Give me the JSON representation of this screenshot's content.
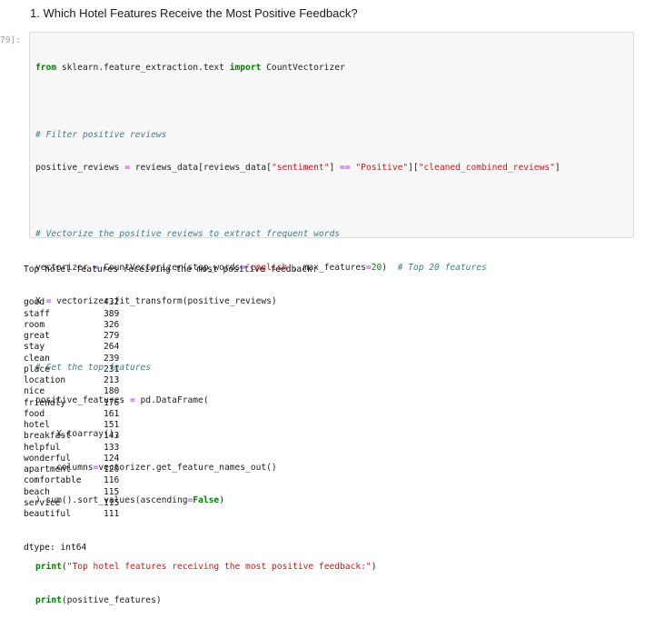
{
  "heading": "1. Which Hotel Features Receive the Most Positive Feedback?",
  "cell": {
    "prompt": "79]:",
    "code": {
      "line1": {
        "kw1": "from",
        "mod": " sklearn.feature_extraction.text ",
        "kw2": "import",
        "name": " CountVectorizer"
      },
      "line2": {
        "comment": "# Filter positive reviews"
      },
      "line3": {
        "a": "positive_reviews ",
        "op1": "=",
        "b": " reviews_data[reviews_data[",
        "s1": "\"sentiment\"",
        "c": "] ",
        "op2": "==",
        "d": " ",
        "s2": "\"Positive\"",
        "e": "][",
        "s3": "\"cleaned_combined_reviews\"",
        "f": "]"
      },
      "line4": {
        "comment": "# Vectorize the positive reviews to extract frequent words"
      },
      "line5": {
        "a": "vectorizer ",
        "op1": "=",
        "b": " CountVectorizer(stop_words",
        "op2": "=",
        "s1": "'english'",
        "c": ", max_features",
        "op3": "=",
        "n1": "20",
        "d": ")  ",
        "comment": "# Top 20 features"
      },
      "line6": {
        "a": "X ",
        "op1": "=",
        "b": " vectorizer.fit_transform(positive_reviews)"
      },
      "line7": {
        "comment": "# Get the top features"
      },
      "line8": {
        "a": "positive_features ",
        "op1": "=",
        "b": " pd.DataFrame("
      },
      "line9": {
        "a": "    X.toarray(),"
      },
      "line10": {
        "a": "    columns",
        "op1": "=",
        "b": "vectorizer.get_feature_names_out()"
      },
      "line11": {
        "a": ").sum().sort_values(ascending",
        "op1": "=",
        "kw1": "False",
        "b": ")"
      },
      "line12": {
        "kw1": "print",
        "a": "(",
        "s1": "\"Top hotel features receiving the most positive feedback:\"",
        "b": ")"
      },
      "line13": {
        "kw1": "print",
        "a": "(positive_features)"
      }
    }
  },
  "output": {
    "header": "Top hotel features receiving the most positive feedback:",
    "rows": [
      {
        "word": "good",
        "count": "432"
      },
      {
        "word": "staff",
        "count": "389"
      },
      {
        "word": "room",
        "count": "326"
      },
      {
        "word": "great",
        "count": "279"
      },
      {
        "word": "stay",
        "count": "264"
      },
      {
        "word": "clean",
        "count": "239"
      },
      {
        "word": "place",
        "count": "231"
      },
      {
        "word": "location",
        "count": "213"
      },
      {
        "word": "nice",
        "count": "180"
      },
      {
        "word": "friendly",
        "count": "176"
      },
      {
        "word": "food",
        "count": "161"
      },
      {
        "word": "hotel",
        "count": "151"
      },
      {
        "word": "breakfast",
        "count": "143"
      },
      {
        "word": "helpful",
        "count": "133"
      },
      {
        "word": "wonderful",
        "count": "124"
      },
      {
        "word": "apartment",
        "count": "120"
      },
      {
        "word": "comfortable",
        "count": "116"
      },
      {
        "word": "beach",
        "count": "115"
      },
      {
        "word": "service",
        "count": "115"
      },
      {
        "word": "beautiful",
        "count": "111"
      }
    ],
    "dtype": "dtype: int64"
  }
}
